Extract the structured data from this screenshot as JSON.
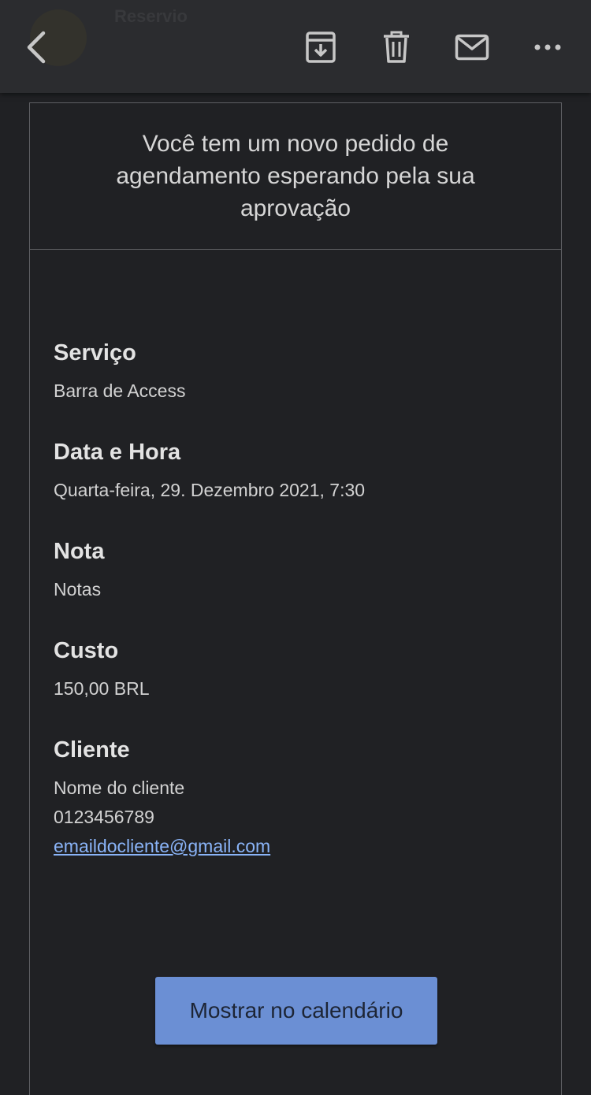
{
  "toolbar": {
    "sender_ghost": "Reservio",
    "icons": [
      "back-icon",
      "archive-icon",
      "trash-icon",
      "mail-icon",
      "more-icon"
    ]
  },
  "email": {
    "headline": "Você tem um novo pedido de agendamento esperando pela sua aprovação",
    "fields": [
      {
        "label": "Serviço",
        "value": "Barra de Access"
      },
      {
        "label": "Data e Hora",
        "value": "Quarta-feira, 29. Dezembro 2021, 7:30"
      },
      {
        "label": "Nota",
        "value": "Notas"
      },
      {
        "label": "Custo",
        "value": "150,00 BRL"
      }
    ],
    "client": {
      "label": "Cliente",
      "name": "Nome do cliente",
      "phone": "0123456789",
      "email": "emaildocliente@gmail.com"
    },
    "cta_label": "Mostrar no calendário"
  },
  "colors": {
    "background": "#202124",
    "toolbar": "#2b2c2f",
    "link": "#8ab4f8",
    "button": "#6b8fd4"
  }
}
